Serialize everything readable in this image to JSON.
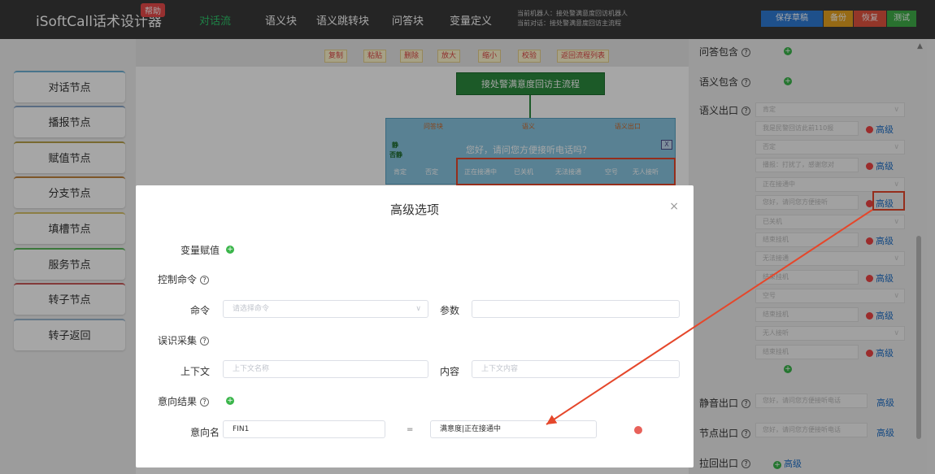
{
  "app": {
    "title": "iSoftCall话术设计器",
    "help_badge": "帮助"
  },
  "nav": [
    {
      "label": "对话流"
    },
    {
      "label": "语义块"
    },
    {
      "label": "语义跳转块"
    },
    {
      "label": "问答块"
    },
    {
      "label": "变量定义"
    }
  ],
  "session": {
    "robot": "当前机器人：接处警满意度回访机器人",
    "dialog": "当前对话：接处警满意度回访主流程"
  },
  "top_buttons": [
    {
      "label": "保存草稿",
      "color": "#2e7bd6"
    },
    {
      "label": "备份",
      "color": "#e7a321"
    },
    {
      "label": "恢复",
      "color": "#e2533f"
    },
    {
      "label": "测试",
      "color": "#3fae49"
    }
  ],
  "node_types": [
    "对话节点",
    "播报节点",
    "赋值节点",
    "分支节点",
    "填槽节点",
    "服务节点",
    "转子节点",
    "转子返回"
  ],
  "canvas_toolbar": [
    "复制",
    "粘贴",
    "删除",
    "放大",
    "缩小",
    "校验",
    "返回流程列表"
  ],
  "flow": {
    "main_node": "接处警满意度回访主流程",
    "card_text": "您好，请问您方便接听电话吗？",
    "top_labels": [
      "问答块",
      "语义",
      "语义出口"
    ],
    "side_labels": [
      "静",
      "否静"
    ],
    "exits": [
      "肯定",
      "否定",
      "正在接通中",
      "已关机",
      "无法接通",
      "空号",
      "无人接听"
    ]
  },
  "right_panel": {
    "qa_include": "问答包含",
    "semantic_include": "语义包含",
    "semantic_exit": "语义出口",
    "exit_rows": [
      {
        "select": "肯定",
        "input": "我是民警回访此前110报"
      },
      {
        "select": "否定",
        "input": "播报：打扰了，感谢您对"
      },
      {
        "select": "正在接通中",
        "input": "您好，请问您方便接听"
      },
      {
        "select": "已关机",
        "input": "结束挂机"
      },
      {
        "select": "无法接通",
        "input": "结束挂机"
      },
      {
        "select": "空号",
        "input": "结束挂机"
      },
      {
        "select": "无人接听",
        "input": "结束挂机"
      }
    ],
    "advanced": "高级",
    "silence_exit": "静音出口",
    "silence_value": "您好，请问您方便接听电话",
    "node_exit": "节点出口",
    "node_exit_value": "您好，请问您方便接听电话",
    "pullback_exit": "拉回出口",
    "pullback_advanced": "高级"
  },
  "modal": {
    "title": "高级选项",
    "close": "×",
    "var_assign": "变量赋值",
    "control_cmd": "控制命令",
    "cmd_label": "命令",
    "cmd_placeholder": "请选择命令",
    "param_label": "参数",
    "misrecog": "误识采集",
    "context_label": "上下文",
    "context_placeholder": "上下文名称",
    "content_label": "内容",
    "content_placeholder": "上下文内容",
    "intent_result": "意向结果",
    "intent_name_label": "意向名",
    "intent_name_value": "FIN1",
    "equals": "=",
    "intent_value": "满意度|正在接通中"
  }
}
